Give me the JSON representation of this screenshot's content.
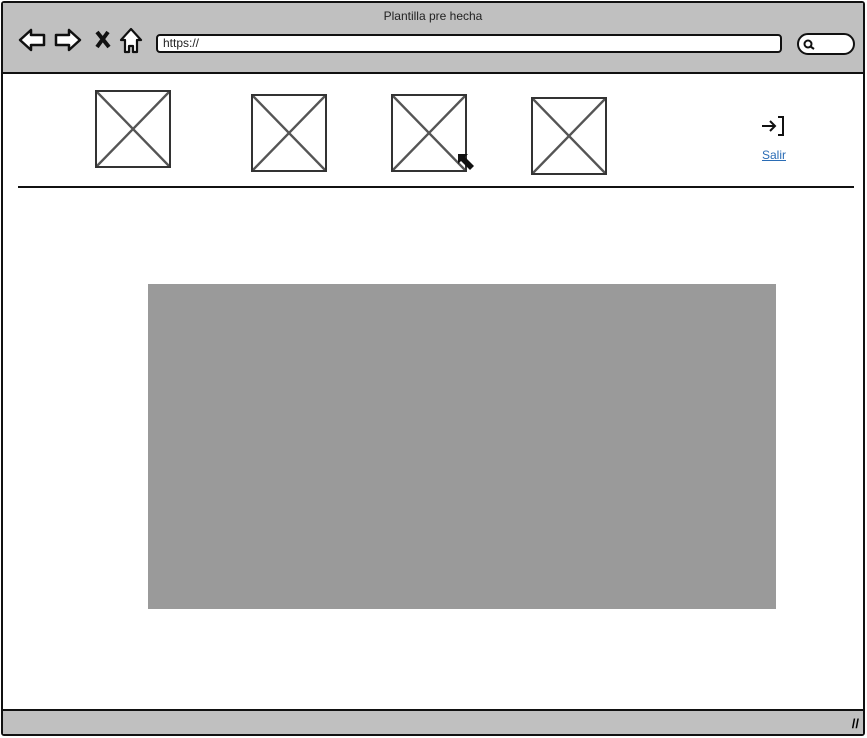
{
  "window": {
    "title": "Plantilla pre hecha"
  },
  "toolbar": {
    "url": "https://",
    "icons": [
      "back-icon",
      "forward-icon",
      "stop-icon",
      "home-icon",
      "search-icon"
    ]
  },
  "nav": {
    "images": [
      "image-placeholder-1",
      "image-placeholder-2",
      "image-placeholder-3",
      "image-placeholder-4"
    ],
    "logout_label": "Salir"
  },
  "colors": {
    "chrome": "#c0c0c0",
    "content": "#9a9a9a",
    "link": "#2a6cb5"
  }
}
